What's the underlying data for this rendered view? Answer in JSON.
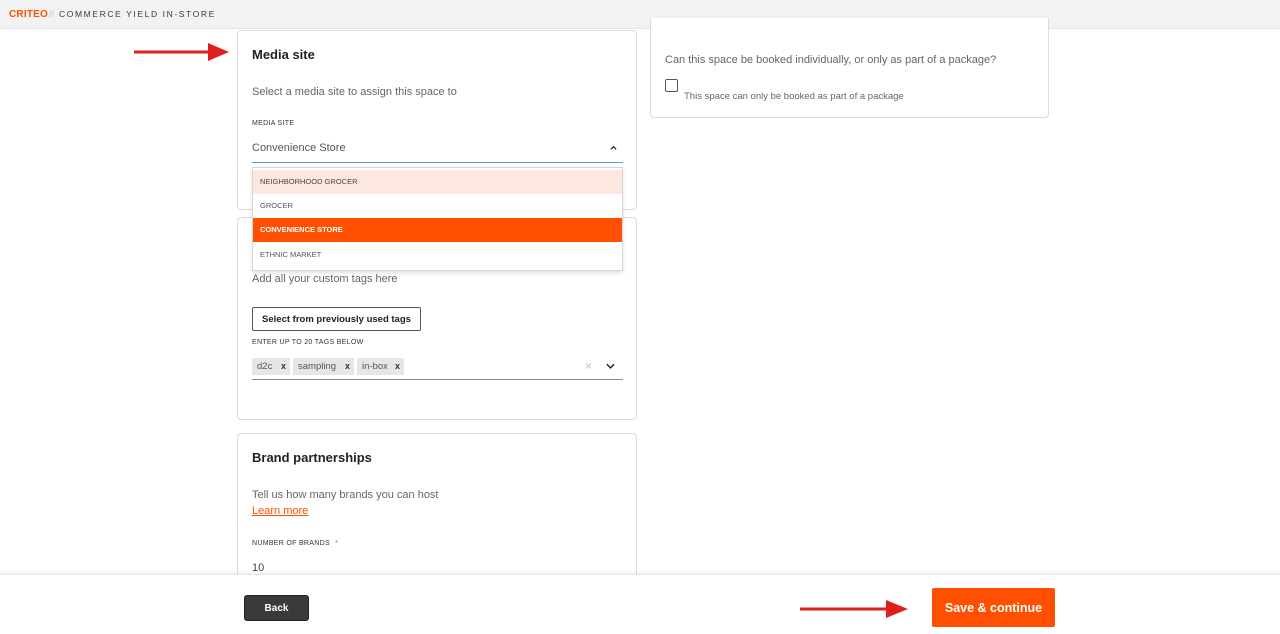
{
  "header": {
    "logo": "CRITEO",
    "separator": "//",
    "product": "COMMERCE YIELD IN-STORE"
  },
  "media_site_card": {
    "title": "Media site",
    "description": "Select a media site to assign this space to",
    "field_label": "MEDIA SITE",
    "selected_value": "Convenience Store",
    "options": [
      {
        "label": "NEIGHBORHOOD GROCER",
        "state": "hover"
      },
      {
        "label": "GROCER",
        "state": "normal"
      },
      {
        "label": "CONVENIENCE STORE",
        "state": "selected"
      },
      {
        "label": "ETHNIC MARKET",
        "state": "normal"
      }
    ]
  },
  "tags_card": {
    "description": "Add all your custom tags here",
    "previous_tags_button": "Select from previously used tags",
    "field_label": "ENTER UP TO 20 TAGS BELOW",
    "tags": [
      "d2c",
      "sampling",
      "in-box"
    ],
    "remove_glyph": "x",
    "clear_glyph": "×"
  },
  "brand_card": {
    "title": "Brand partnerships",
    "description": "Tell us how many brands you can host",
    "learn_more": "Learn more",
    "field_label": "NUMBER OF BRANDS",
    "required_mark": "*",
    "value": "10"
  },
  "package_card": {
    "question": "Can this space be booked individually, or only as part of a package?",
    "checkbox_label": "This space can only be booked as part of a package",
    "checked": false
  },
  "footer": {
    "back_label": "Back",
    "save_label": "Save & continue"
  },
  "colors": {
    "accent": "#fe5000",
    "hover_row": "#fde8e0",
    "arrow": "#e01e1e",
    "back_button": "#3a3a3a"
  },
  "icons": [
    "chevron-up-icon",
    "chevron-down-icon",
    "clear-icon",
    "remove-tag-icon",
    "arrow-annotation-icon"
  ]
}
